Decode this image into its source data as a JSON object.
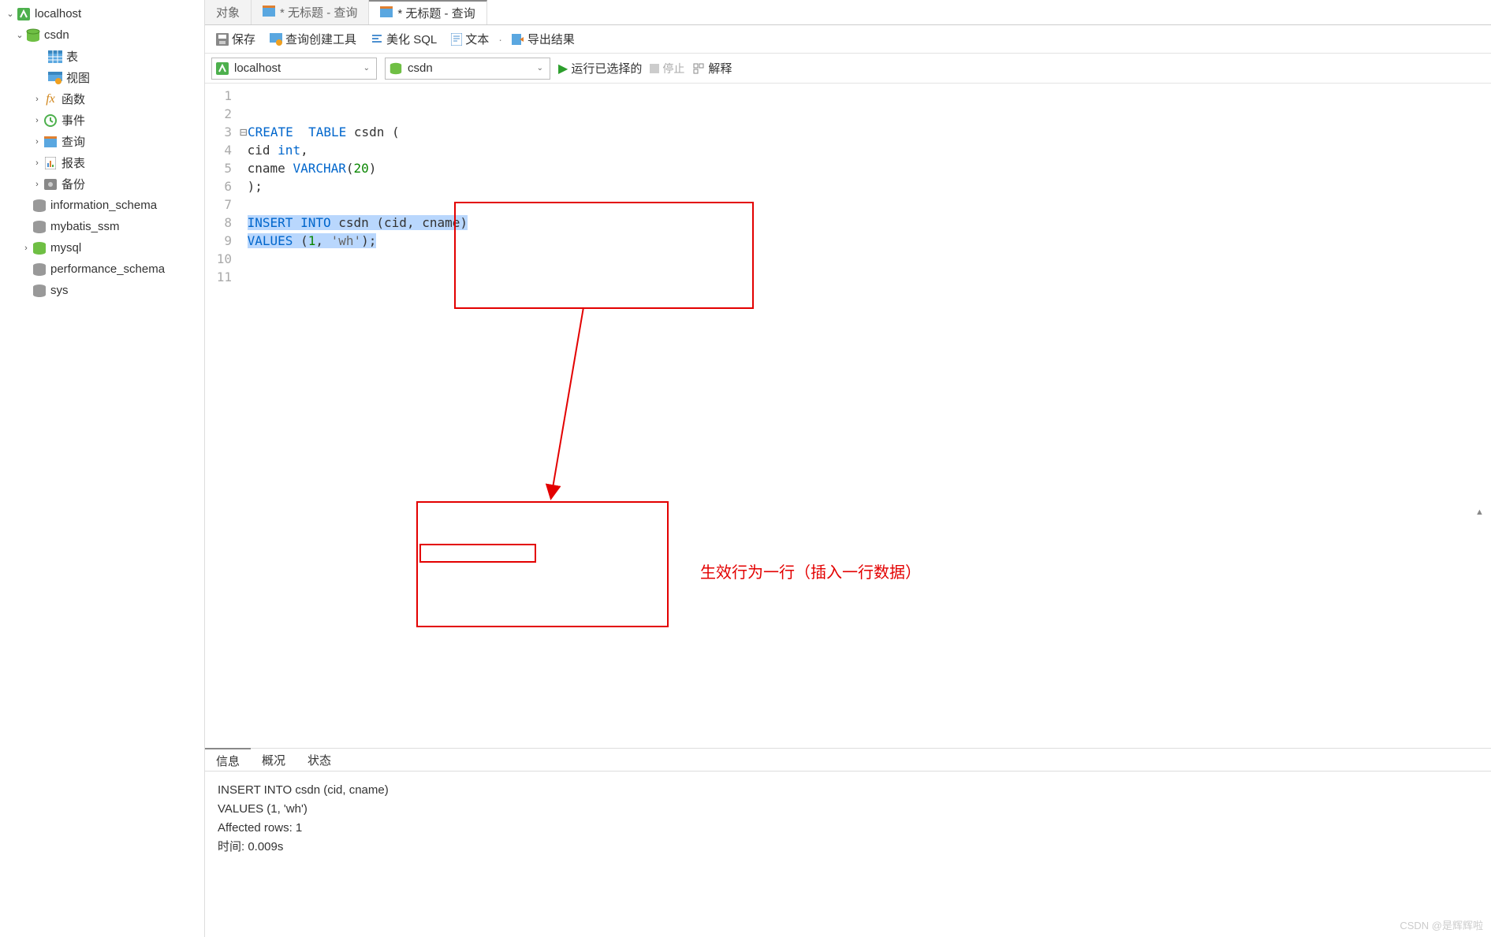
{
  "sidebar": {
    "host": "localhost",
    "databases": [
      {
        "name": "csdn",
        "expanded": true,
        "children": [
          {
            "label": "表",
            "icon": "table-icon"
          },
          {
            "label": "视图",
            "icon": "view-icon"
          },
          {
            "label": "函数",
            "icon": "function-icon",
            "expandable": true
          },
          {
            "label": "事件",
            "icon": "event-icon",
            "expandable": true
          },
          {
            "label": "查询",
            "icon": "query-icon",
            "expandable": true
          },
          {
            "label": "报表",
            "icon": "report-icon",
            "expandable": true
          },
          {
            "label": "备份",
            "icon": "backup-icon",
            "expandable": true
          }
        ]
      },
      {
        "name": "information_schema"
      },
      {
        "name": "mybatis_ssm"
      },
      {
        "name": "mysql",
        "expandable": true
      },
      {
        "name": "performance_schema"
      },
      {
        "name": "sys"
      }
    ]
  },
  "tabs": {
    "items": [
      {
        "label": "对象",
        "active": false,
        "icon": null
      },
      {
        "label": "* 无标题 - 查询",
        "active": false,
        "icon": "query"
      },
      {
        "label": "* 无标题 - 查询",
        "active": true,
        "icon": "query"
      }
    ]
  },
  "toolbar": {
    "save": "保存",
    "query_builder": "查询创建工具",
    "beautify": "美化 SQL",
    "text": "文本",
    "export": "导出结果"
  },
  "connbar": {
    "host_dd": "localhost",
    "db_dd": "csdn",
    "run": "运行已选择的",
    "stop": "停止",
    "explain": "解释"
  },
  "code": {
    "lines": [
      "1",
      "2",
      "3",
      "4",
      "5",
      "6",
      "7",
      "8",
      "9",
      "10",
      "11"
    ],
    "l2_create": "CREATE",
    "l2_table": "TABLE",
    "l2_name": " csdn (",
    "l3_col": " cid ",
    "l3_type": "int",
    "l3_end": ",",
    "l4_col": " cname ",
    "l4_type": "VARCHAR",
    "l4_p": "(",
    "l4_num": "20",
    "l4_p2": ")",
    "l5": " );",
    "l7_insert": "INSERT",
    "l7_into": "INTO",
    "l7_rest": " csdn (cid, cname)",
    "l8_values": "VALUES",
    "l8_p": " (",
    "l8_num": "1",
    "l8_c": ", ",
    "l8_str": "'wh'",
    "l8_end": ");"
  },
  "bottom_tabs": {
    "info": "信息",
    "profile": "概况",
    "status": "状态"
  },
  "result": {
    "line1": "INSERT INTO csdn (cid, cname)",
    "line2": "VALUES (1, 'wh')",
    "line3": "Affected rows: 1",
    "line4": "时间: 0.009s"
  },
  "annotation": "生效行为一行（插入一行数据）",
  "watermark": "CSDN @是辉辉啦"
}
